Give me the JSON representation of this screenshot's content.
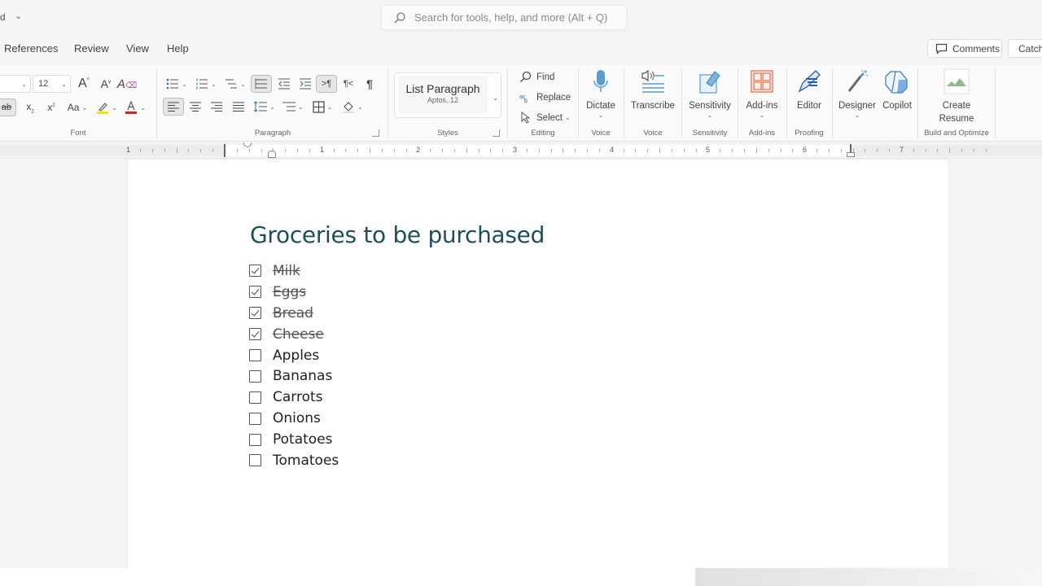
{
  "titlebar": {
    "doc_name_fragment": "d",
    "search_placeholder": "Search for tools, help, and more (Alt + Q)"
  },
  "menu": {
    "tabs": [
      {
        "label": "References"
      },
      {
        "label": "Review"
      },
      {
        "label": "View"
      },
      {
        "label": "Help"
      }
    ],
    "comments_label": "Comments",
    "catchup_label": "Catch up"
  },
  "ribbon": {
    "font": {
      "font_name": "",
      "font_size": "12",
      "group_label": "Font",
      "buttons": [
        "grow-font",
        "shrink-font",
        "clear-formatting",
        "strikethrough",
        "subscript",
        "superscript",
        "change-case",
        "highlight",
        "font-color"
      ],
      "highlight_color": "#f2e600",
      "font_color": "#e02020"
    },
    "paragraph": {
      "group_label": "Paragraph"
    },
    "styles": {
      "style_name": "List Paragraph",
      "style_font": "Aptos, 12",
      "group_label": "Styles"
    },
    "editing": {
      "find_label": "Find",
      "replace_label": "Replace",
      "select_label": "Select",
      "group_label": "Editing"
    },
    "voice": {
      "dictate_label": "Dictate",
      "dictate_group": "Voice",
      "transcribe_label": "Transcribe",
      "transcribe_group": "Voice"
    },
    "sensitivity": {
      "label": "Sensitivity",
      "group_label": "Sensitivity"
    },
    "addins": {
      "label": "Add-ins",
      "group_label": "Add-ins"
    },
    "proofing": {
      "editor_label": "Editor",
      "group_label": "Proofing"
    },
    "designer_label": "Designer",
    "copilot_label": "Copilot",
    "build": {
      "create_label": "Create",
      "resume_label": "Resume",
      "group_label": "Build and Optimize"
    }
  },
  "ruler": {
    "numbers": [
      "1",
      "1",
      "2",
      "3",
      "4",
      "5",
      "6",
      "7"
    ]
  },
  "document": {
    "title": "Groceries to be purchased",
    "items": [
      {
        "text": "Milk",
        "checked": true
      },
      {
        "text": "Eggs",
        "checked": true
      },
      {
        "text": "Bread",
        "checked": true
      },
      {
        "text": "Cheese",
        "checked": true
      },
      {
        "text": "Apples",
        "checked": false
      },
      {
        "text": "Bananas",
        "checked": false
      },
      {
        "text": "Carrots",
        "checked": false
      },
      {
        "text": "Onions",
        "checked": false
      },
      {
        "text": "Potatoes",
        "checked": false
      },
      {
        "text": "Tomatoes",
        "checked": false
      }
    ],
    "title_color": "#1f4e5a"
  }
}
